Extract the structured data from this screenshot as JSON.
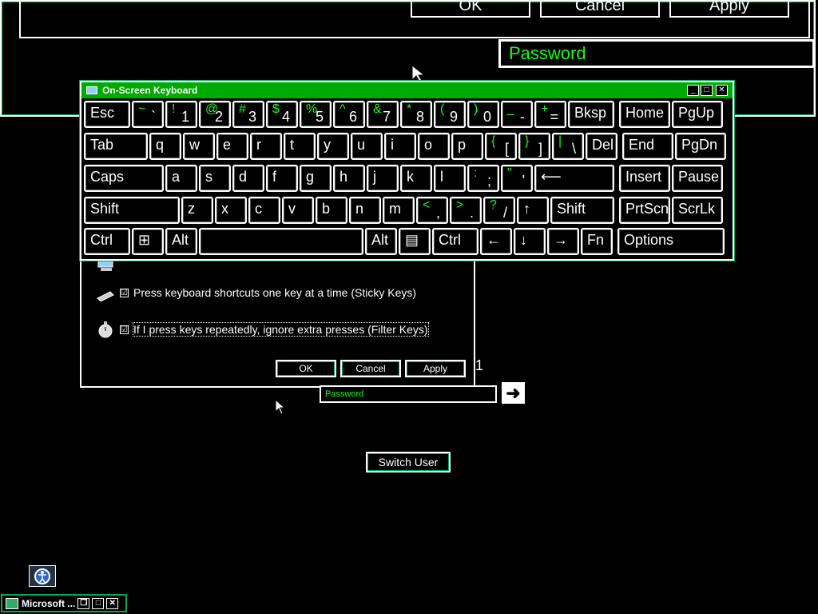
{
  "background": {
    "buttons": [
      "OK",
      "Cancel",
      "Apply"
    ],
    "password_placeholder": "Password"
  },
  "osk": {
    "title": "On-Screen Keyboard",
    "rows": [
      [
        {
          "main": "Esc",
          "w": 58
        },
        {
          "hi": "~",
          "lo": "`",
          "w": 40
        },
        {
          "hi": "!",
          "lo": "1",
          "w": 40
        },
        {
          "hi": "@",
          "lo": "2",
          "w": 40
        },
        {
          "hi": "#",
          "lo": "3",
          "w": 40
        },
        {
          "hi": "$",
          "lo": "4",
          "w": 40
        },
        {
          "hi": "%",
          "lo": "5",
          "w": 40
        },
        {
          "hi": "^",
          "lo": "6",
          "w": 40
        },
        {
          "hi": "&",
          "lo": "7",
          "w": 40
        },
        {
          "hi": "*",
          "lo": "8",
          "w": 40
        },
        {
          "hi": "(",
          "lo": "9",
          "w": 40
        },
        {
          "hi": ")",
          "lo": "0",
          "w": 40
        },
        {
          "hi": "_",
          "lo": "-",
          "w": 40
        },
        {
          "hi": "+",
          "lo": "=",
          "w": 40
        },
        {
          "main": "Bksp",
          "w": 58
        },
        {
          "main": "Home",
          "w": 64
        },
        {
          "main": "PgUp",
          "w": 64
        }
      ],
      [
        {
          "main": "Tab",
          "w": 80
        },
        {
          "main": "q",
          "w": 40
        },
        {
          "main": "w",
          "w": 40
        },
        {
          "main": "e",
          "w": 40
        },
        {
          "main": "r",
          "w": 40
        },
        {
          "main": "t",
          "w": 40
        },
        {
          "main": "y",
          "w": 40
        },
        {
          "main": "u",
          "w": 40
        },
        {
          "main": "i",
          "w": 40
        },
        {
          "main": "o",
          "w": 40
        },
        {
          "main": "p",
          "w": 40
        },
        {
          "hi": "{",
          "lo": "[",
          "w": 40
        },
        {
          "hi": "}",
          "lo": "]",
          "w": 40
        },
        {
          "hi": "|",
          "lo": "\\",
          "w": 40
        },
        {
          "main": "Del",
          "w": 40
        },
        {
          "main": "End",
          "w": 64
        },
        {
          "main": "PgDn",
          "w": 64
        }
      ],
      [
        {
          "main": "Caps",
          "w": 100
        },
        {
          "main": "a",
          "w": 40
        },
        {
          "main": "s",
          "w": 40
        },
        {
          "main": "d",
          "w": 40
        },
        {
          "main": "f",
          "w": 40
        },
        {
          "main": "g",
          "w": 40
        },
        {
          "main": "h",
          "w": 40
        },
        {
          "main": "j",
          "w": 40
        },
        {
          "main": "k",
          "w": 40
        },
        {
          "main": "l",
          "w": 40
        },
        {
          "hi": ":",
          "lo": ";",
          "w": 40
        },
        {
          "hi": "\"",
          "lo": "'",
          "w": 40
        },
        {
          "main": "⟵",
          "w": 100
        },
        {
          "main": "Insert",
          "w": 64
        },
        {
          "main": "Pause",
          "w": 64
        }
      ],
      [
        {
          "main": "Shift",
          "w": 120
        },
        {
          "main": "z",
          "w": 40
        },
        {
          "main": "x",
          "w": 40
        },
        {
          "main": "c",
          "w": 40
        },
        {
          "main": "v",
          "w": 40
        },
        {
          "main": "b",
          "w": 40
        },
        {
          "main": "n",
          "w": 40
        },
        {
          "main": "m",
          "w": 40
        },
        {
          "hi": "<",
          "lo": ",",
          "w": 40
        },
        {
          "hi": ">",
          "lo": ".",
          "w": 40
        },
        {
          "hi": "?",
          "lo": "/",
          "w": 40
        },
        {
          "main": "↑",
          "w": 40
        },
        {
          "main": "Shift",
          "w": 80
        },
        {
          "main": "PrtScn",
          "w": 64
        },
        {
          "main": "ScrLk",
          "w": 64
        }
      ],
      [
        {
          "main": "Ctrl",
          "w": 58
        },
        {
          "main": "⊞",
          "w": 40
        },
        {
          "main": "Alt",
          "w": 40
        },
        {
          "main": "",
          "w": 206
        },
        {
          "main": "Alt",
          "w": 40
        },
        {
          "main": "▤",
          "w": 40
        },
        {
          "main": "Ctrl",
          "w": 58
        },
        {
          "main": "←",
          "w": 40
        },
        {
          "main": "↓",
          "w": 40
        },
        {
          "main": "→",
          "w": 40
        },
        {
          "main": "Fn",
          "w": 40
        },
        {
          "main": "Options",
          "w": 134
        }
      ]
    ]
  },
  "ease_dialog": {
    "options": [
      {
        "label": "Press keyboard shortcuts one key at a time (Sticky Keys)",
        "checked": "☑"
      },
      {
        "label": "If I press keys repeatedly, ignore extra presses (Filter Keys)",
        "checked": "☑"
      }
    ],
    "buttons": {
      "ok": "OK",
      "cancel": "Cancel",
      "apply": "Apply"
    }
  },
  "login": {
    "password_placeholder": "Password",
    "submit_arrow": "➜",
    "switch_user": "Switch User",
    "digit": "1"
  },
  "taskbar": {
    "label": "Microsoft ..."
  }
}
